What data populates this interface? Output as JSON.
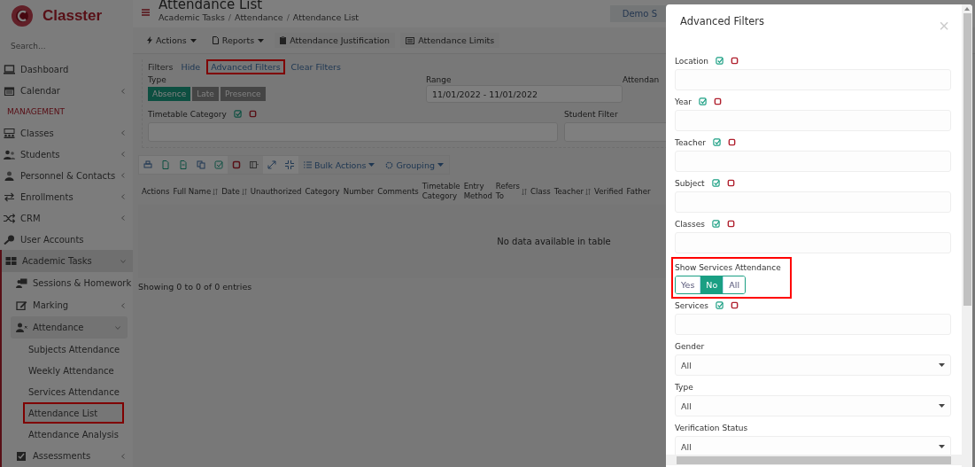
{
  "sidebar": {
    "logo": "Classter",
    "search": {
      "placeholder": "Search..."
    },
    "items": [
      {
        "kind": "link",
        "label": "Dashboard",
        "selected": false
      },
      {
        "kind": "menu",
        "label": "Calendar",
        "expanded": false,
        "selected": false
      },
      {
        "kind": "header",
        "label": "MANAGEMENT"
      },
      {
        "kind": "menu",
        "label": "Classes",
        "expanded": false,
        "selected": false
      },
      {
        "kind": "menu",
        "label": "Students",
        "expanded": false,
        "selected": false
      },
      {
        "kind": "menu",
        "label": "Personnel & Contacts",
        "expanded": false,
        "selected": false
      },
      {
        "kind": "menu",
        "label": "Enrollments",
        "expanded": false,
        "selected": false
      },
      {
        "kind": "menu",
        "label": "CRM",
        "expanded": false,
        "selected": false
      },
      {
        "kind": "link",
        "label": "User Accounts",
        "selected": false
      },
      {
        "kind": "menu",
        "label": "Academic Tasks",
        "expanded": true,
        "selected": true,
        "children": [
          {
            "kind": "menu",
            "label": "Sessions & Homework",
            "expanded": false,
            "selected": false
          },
          {
            "kind": "menu",
            "label": "Marking",
            "expanded": false,
            "selected": false
          },
          {
            "kind": "menu",
            "label": "Attendance",
            "expanded": true,
            "selected": true,
            "children": [
              {
                "kind": "link",
                "label": "Subjects Attendance",
                "selected": false,
                "highlighted": false
              },
              {
                "kind": "link",
                "label": "Weekly Attendance",
                "selected": false,
                "highlighted": false
              },
              {
                "kind": "link",
                "label": "Services Attendance",
                "selected": false,
                "highlighted": false
              },
              {
                "kind": "link",
                "label": "Attendance List",
                "selected": true,
                "highlighted": true
              },
              {
                "kind": "link",
                "label": "Attendance Analysis",
                "selected": false,
                "highlighted": false
              }
            ]
          },
          {
            "kind": "menu",
            "label": "Assessments",
            "expanded": false,
            "selected": false
          }
        ]
      }
    ]
  },
  "header": {
    "title": "Attendance List",
    "breadcrumb": [
      {
        "kind": "link",
        "label": "Academic Tasks"
      },
      {
        "kind": "separator",
        "label": "/"
      },
      {
        "kind": "link",
        "label": "Attendance"
      },
      {
        "kind": "separator",
        "label": "/"
      },
      {
        "kind": "link",
        "label": "Attendance List"
      }
    ],
    "school_button": "Demo S"
  },
  "toolbar": [
    {
      "label": "Actions",
      "dropdown": true
    },
    {
      "label": "Reports",
      "dropdown": true
    },
    {
      "label": "Attendance Justification",
      "dropdown": false
    },
    {
      "label": "Attendance Limits",
      "dropdown": false
    }
  ],
  "filters_bar": {
    "title": "Filters",
    "links": [
      {
        "label": "Hide",
        "highlighted": false
      },
      {
        "label": "Advanced Filters",
        "highlighted": true
      },
      {
        "label": "Clear Filters",
        "highlighted": false
      }
    ]
  },
  "filters": {
    "type": {
      "label": "Type",
      "options": [
        {
          "label": "Absence",
          "selected": true
        },
        {
          "label": "Late",
          "selected": false
        },
        {
          "label": "Presence",
          "selected": false
        }
      ]
    },
    "range": {
      "label": "Range",
      "value": "11/01/2022 - 11/01/2022"
    },
    "column_3_label": "Attendan",
    "timetable_category": {
      "label": "Timetable Category"
    },
    "student_filter": {
      "label": "Student Filter"
    }
  },
  "table": {
    "bulk_actions": "Bulk Actions",
    "grouping": "Grouping",
    "columns": [
      {
        "label": "Actions",
        "sortable": false
      },
      {
        "label": "Full Name",
        "sortable": true,
        "wrapped": false
      },
      {
        "label": "Date",
        "sortable": true
      },
      {
        "label": "Unauthorized",
        "sortable": false
      },
      {
        "label": "Category",
        "sortable": false
      },
      {
        "label": "Number",
        "sortable": false
      },
      {
        "label": "Comments",
        "sortable": false
      },
      {
        "label": "Timetable Category",
        "sortable": false,
        "wrapped": true
      },
      {
        "label": "Entry Method",
        "sortable": false,
        "wrapped": true
      },
      {
        "label": "Refers To",
        "sortable": true,
        "wrapped": true
      },
      {
        "label": "Class",
        "sortable": false
      },
      {
        "label": "Teacher",
        "sortable": true
      },
      {
        "label": "Verified",
        "sortable": false
      },
      {
        "label": "Father",
        "sortable": false
      }
    ],
    "empty_message": "No data available in table",
    "info": "Showing 0 to 0 of 0 entries"
  },
  "modal": {
    "title": "Advanced Filters",
    "close": "×",
    "fields": [
      {
        "kind": "multi",
        "label": "Location"
      },
      {
        "kind": "multi",
        "label": "Year"
      },
      {
        "kind": "multi",
        "label": "Teacher"
      },
      {
        "kind": "multi",
        "label": "Subject"
      },
      {
        "kind": "multi",
        "label": "Classes"
      },
      {
        "kind": "toggle",
        "label": "Show Services Attendance",
        "highlighted": true,
        "options": [
          {
            "label": "Yes",
            "selected": false
          },
          {
            "label": "No",
            "selected": true
          },
          {
            "label": "All",
            "selected": false
          }
        ]
      },
      {
        "kind": "multi",
        "label": "Services"
      },
      {
        "kind": "select",
        "label": "Gender",
        "value": "All"
      },
      {
        "kind": "select",
        "label": "Type",
        "value": "All"
      },
      {
        "kind": "select",
        "label": "Verification Status",
        "value": "All"
      }
    ]
  }
}
